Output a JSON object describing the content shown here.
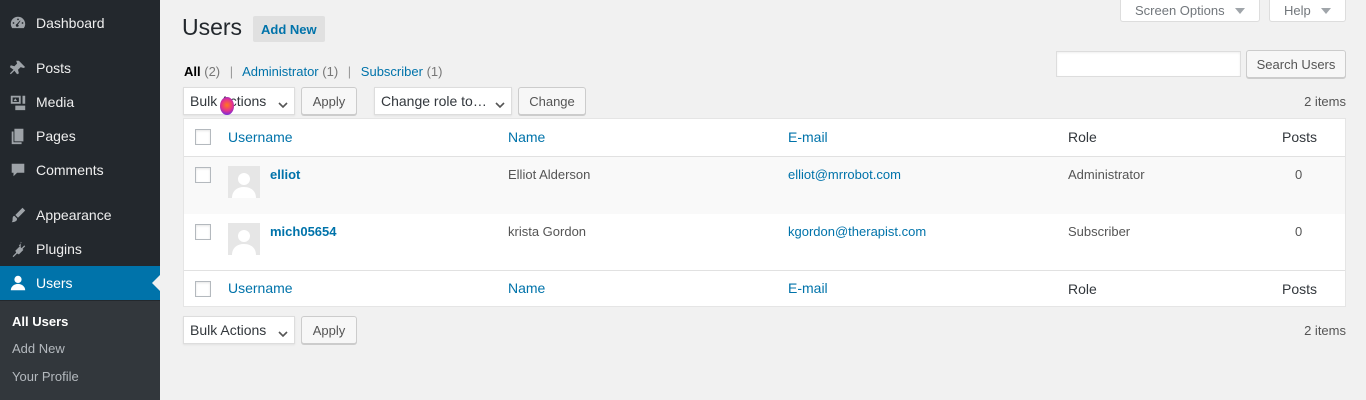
{
  "sidebar": {
    "items": [
      {
        "label": "Dashboard",
        "icon": "dashboard-icon"
      },
      {
        "label": "Posts",
        "icon": "pin-icon"
      },
      {
        "label": "Media",
        "icon": "media-icon"
      },
      {
        "label": "Pages",
        "icon": "pages-icon"
      },
      {
        "label": "Comments",
        "icon": "comment-icon"
      },
      {
        "label": "Appearance",
        "icon": "brush-icon"
      },
      {
        "label": "Plugins",
        "icon": "plug-icon"
      },
      {
        "label": "Users",
        "icon": "user-icon"
      }
    ],
    "submenu": [
      "All Users",
      "Add New",
      "Your Profile"
    ]
  },
  "header": {
    "title": "Users",
    "add_new": "Add New",
    "screen_options": "Screen Options",
    "help": "Help"
  },
  "filters": {
    "all": "All",
    "all_count": "(2)",
    "administrator": "Administrator",
    "administrator_count": "(1)",
    "subscriber": "Subscriber",
    "subscriber_count": "(1)",
    "separator": "|"
  },
  "search": {
    "value": "",
    "button": "Search Users"
  },
  "actions": {
    "bulk_actions": "Bulk Actions",
    "apply": "Apply",
    "change_role": "Change role to…",
    "change": "Change",
    "items_count": "2 items"
  },
  "table": {
    "columns": [
      "Username",
      "Name",
      "E-mail",
      "Role",
      "Posts"
    ],
    "rows": [
      {
        "username": "elliot",
        "name": "Elliot Alderson",
        "email": "elliot@mrrobot.com",
        "role": "Administrator",
        "posts": "0"
      },
      {
        "username": "mich05654",
        "name": "krista Gordon",
        "email": "kgordon@therapist.com",
        "role": "Subscriber",
        "posts": "0"
      }
    ]
  },
  "colors": {
    "sidebar_bg": "#23282d",
    "accent": "#0073aa",
    "page_bg": "#f1f1f1"
  }
}
